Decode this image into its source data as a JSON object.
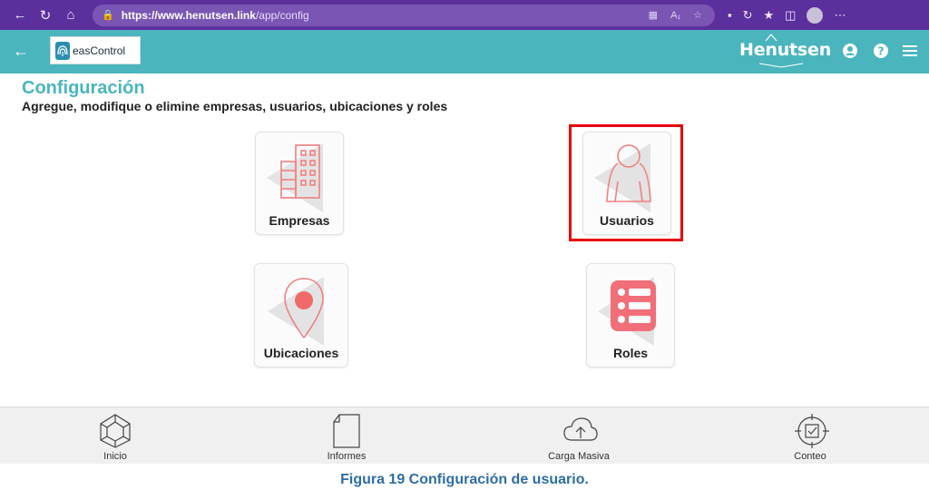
{
  "browser": {
    "url_host": "https://www.henutsen.link",
    "url_path": "/app/config"
  },
  "header": {
    "logo_text": "easControl",
    "brand": "Henutsen"
  },
  "page": {
    "title": "Configuración",
    "subtitle": "Agregue, modifique o elimine empresas, usuarios,  ubicaciones y roles"
  },
  "cards": [
    {
      "label": "Empresas",
      "icon": "building-icon"
    },
    {
      "label": "Usuarios",
      "icon": "user-icon"
    },
    {
      "label": "Ubicaciones",
      "icon": "location-pin-icon"
    },
    {
      "label": "Roles",
      "icon": "list-icon"
    }
  ],
  "bottom_nav": [
    {
      "label": "Inicio",
      "icon": "home-cube-icon"
    },
    {
      "label": "Informes",
      "icon": "document-icon"
    },
    {
      "label": "Carga Masiva",
      "icon": "cloud-upload-icon"
    },
    {
      "label": "Conteo",
      "icon": "target-check-icon"
    }
  ],
  "caption": "Figura 19 Configuración de usuario.",
  "colors": {
    "browser_bar": "#5b2f9c",
    "header": "#4ab5bd",
    "accent_red": "#f08080",
    "highlight": "#e8000b",
    "caption": "#2e6da4"
  }
}
